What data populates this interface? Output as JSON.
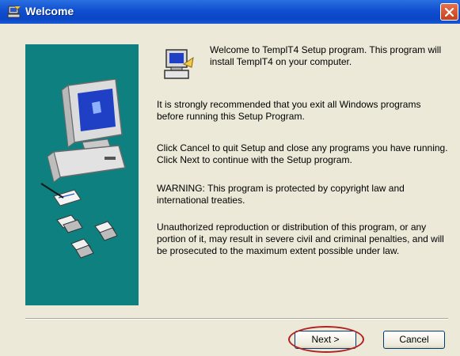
{
  "window": {
    "title": "Welcome",
    "titlebar_color": "#0a46c6",
    "side_panel_color": "#0f8080",
    "close_icon": "close-icon"
  },
  "content": {
    "intro": "Welcome to TemplT4 Setup program. This program will install TemplT4 on your computer.",
    "paragraphs": [
      "It is strongly recommended that you exit all Windows programs before running this Setup Program.",
      "Click Cancel to quit Setup and close any programs you have running.  Click Next to continue with the Setup program.",
      "WARNING: This program is protected by copyright law and international treaties.",
      "Unauthorized reproduction or distribution of this program, or any portion of it, may result in severe civil and criminal penalties, and will be prosecuted to the maximum extent possible under law."
    ]
  },
  "buttons": {
    "next_label": "Next >",
    "cancel_label": "Cancel"
  },
  "annotation": {
    "highlight_color": "#b02222"
  }
}
